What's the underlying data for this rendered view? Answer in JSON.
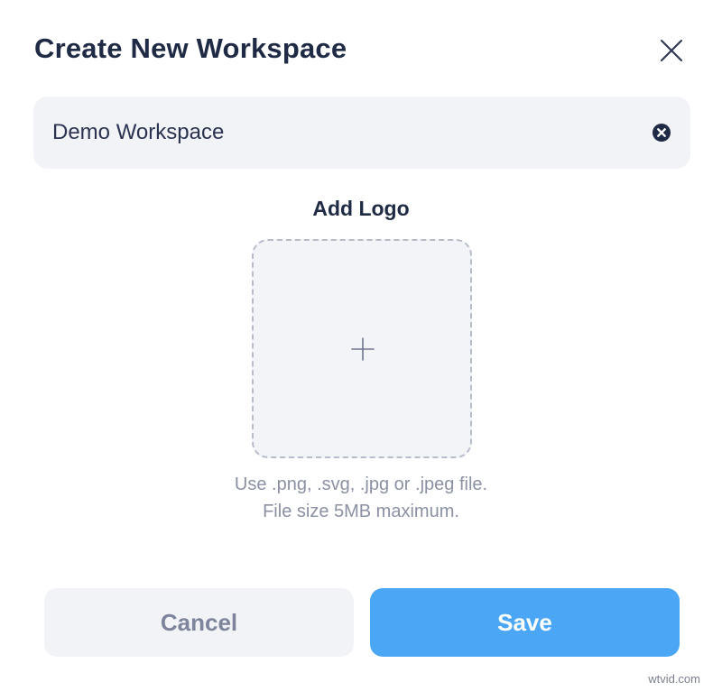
{
  "dialog": {
    "title": "Create New Workspace",
    "close_icon": "close-icon"
  },
  "name_field": {
    "value": "Demo Workspace",
    "clear_icon": "clear-circle-x-icon"
  },
  "logo": {
    "label": "Add Logo",
    "add_icon": "plus-icon",
    "hint_line1": "Use .png, .svg, .jpg or .jpeg file.",
    "hint_line2": "File size 5MB maximum."
  },
  "actions": {
    "cancel_label": "Cancel",
    "save_label": "Save"
  },
  "watermark": "wtvid.com",
  "colors": {
    "title": "#1f2a44",
    "field_bg": "#f2f3f7",
    "accent": "#4ba7f5",
    "muted_text": "#8b91a3"
  }
}
